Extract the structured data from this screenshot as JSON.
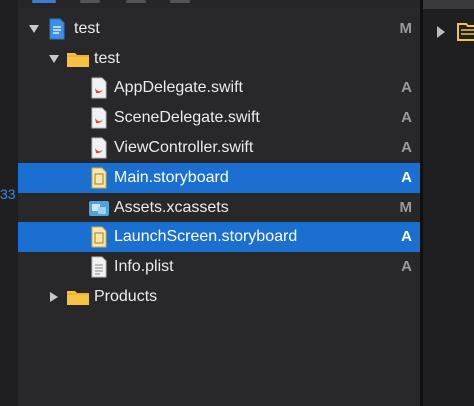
{
  "left_edge_fragment": "33",
  "tree": [
    {
      "label": "test",
      "status": "M",
      "icon": "project-file-icon",
      "disclosure": "open"
    },
    {
      "label": "test",
      "status": "",
      "icon": "folder-icon",
      "disclosure": "open"
    },
    {
      "label": "AppDelegate.swift",
      "status": "A",
      "icon": "swift-file-icon"
    },
    {
      "label": "SceneDelegate.swift",
      "status": "A",
      "icon": "swift-file-icon"
    },
    {
      "label": "ViewController.swift",
      "status": "A",
      "icon": "swift-file-icon"
    },
    {
      "label": "Main.storyboard",
      "status": "A",
      "icon": "storyboard-file-icon",
      "selected": true
    },
    {
      "label": "Assets.xcassets",
      "status": "M",
      "icon": "asset-catalog-icon"
    },
    {
      "label": "LaunchScreen.storyboard",
      "status": "A",
      "icon": "storyboard-file-icon",
      "selected": true
    },
    {
      "label": "Info.plist",
      "status": "A",
      "icon": "plist-file-icon"
    },
    {
      "label": "Products",
      "status": "",
      "icon": "folder-icon",
      "disclosure": "closed"
    }
  ],
  "colors": {
    "selection": "#1a6fd1",
    "folder": "#f5c242",
    "swift": "#e0492d",
    "storyboard": "#e9c46a",
    "asset": "#4fa3e0"
  }
}
